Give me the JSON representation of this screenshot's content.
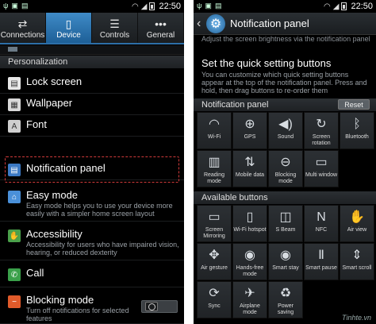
{
  "left": {
    "status": {
      "left_icons": [
        "usb",
        "image",
        "sd"
      ],
      "time": "22:50"
    },
    "tabs": [
      {
        "label": "Connections",
        "icon": "⇄",
        "icon_name": "connections-icon",
        "active": false
      },
      {
        "label": "Device",
        "icon": "▯",
        "icon_name": "device-icon",
        "active": true
      },
      {
        "label": "Controls",
        "icon": "☰",
        "icon_name": "controls-icon",
        "active": false
      },
      {
        "label": "General",
        "icon": "•••",
        "icon_name": "general-icon",
        "active": false
      }
    ],
    "section": "Personalization",
    "items": [
      {
        "label": "Lock screen",
        "sub": "",
        "icon": "▤",
        "color": "#e8e8e8"
      },
      {
        "label": "Wallpaper",
        "sub": "",
        "icon": "▦",
        "color": "#d9d9d9"
      },
      {
        "label": "Font",
        "sub": "",
        "icon": "A",
        "color": "#cfcfcf"
      },
      {
        "label": "Notification panel",
        "sub": "",
        "icon": "▤",
        "color": "#3b79c4"
      },
      {
        "label": "Easy mode",
        "sub": "Easy mode helps you to use your device more easily with a simpler home screen layout",
        "icon": "⌂",
        "color": "#4a90d9"
      },
      {
        "label": "Accessibility",
        "sub": "Accessibility for users who have impaired vision, hearing, or reduced dexterity",
        "icon": "✋",
        "color": "#4aa04a"
      },
      {
        "label": "Call",
        "sub": "",
        "icon": "✆",
        "color": "#3aa04a"
      },
      {
        "label": "Blocking mode",
        "sub": "Turn off notifications for selected features",
        "icon": "−",
        "color": "#e05a2a"
      }
    ]
  },
  "right": {
    "status": {
      "time": "22:50"
    },
    "header": {
      "title": "Notification panel"
    },
    "top_fragment": "Adjust the screen brightness via the notification panel",
    "quick": {
      "title": "Set the quick setting buttons",
      "desc": "You can customize which quick setting buttons appear at the top of the notification panel. Press and hold, then drag buttons to re-order them"
    },
    "panel_title": "Notification panel",
    "reset_label": "Reset",
    "panel_buttons": [
      {
        "label": "Wi-Fi",
        "icon": "◠"
      },
      {
        "label": "GPS",
        "icon": "⊕"
      },
      {
        "label": "Sound",
        "icon": "◀)"
      },
      {
        "label": "Screen rotation",
        "icon": "↻"
      },
      {
        "label": "Bluetooth",
        "icon": "ᛒ"
      },
      {
        "label": "Reading mode",
        "icon": "▥"
      },
      {
        "label": "Mobile data",
        "icon": "⇅"
      },
      {
        "label": "Blocking mode",
        "icon": "⊖"
      },
      {
        "label": "Multi window",
        "icon": "▭"
      }
    ],
    "available_title": "Available buttons",
    "available_buttons": [
      {
        "label": "Screen Mirroring",
        "icon": "▭"
      },
      {
        "label": "Wi-Fi hotspot",
        "icon": "▯"
      },
      {
        "label": "S Beam",
        "icon": "◫"
      },
      {
        "label": "NFC",
        "icon": "N"
      },
      {
        "label": "Air view",
        "icon": "✋"
      },
      {
        "label": "Air gesture",
        "icon": "✥"
      },
      {
        "label": "Hands-free mode",
        "icon": "◉"
      },
      {
        "label": "Smart stay",
        "icon": "◉"
      },
      {
        "label": "Smart pause",
        "icon": "Ⅱ"
      },
      {
        "label": "Smart scroll",
        "icon": "⇕"
      },
      {
        "label": "Sync",
        "icon": "⟳"
      },
      {
        "label": "Airplane mode",
        "icon": "✈"
      },
      {
        "label": "Power saving",
        "icon": "♻"
      }
    ],
    "watermark": "Tinhte.vn"
  }
}
